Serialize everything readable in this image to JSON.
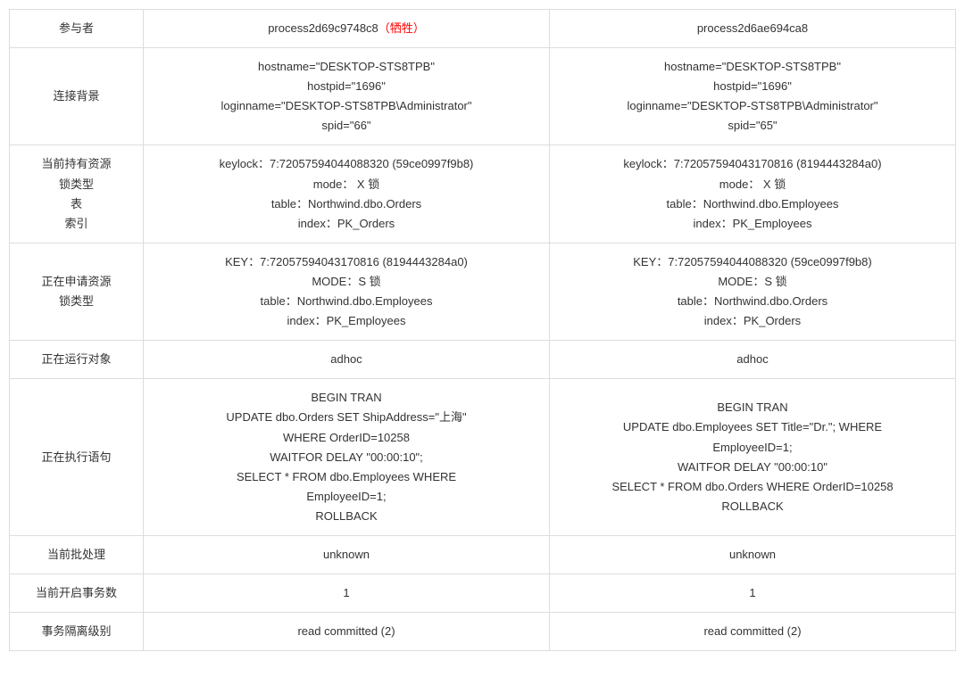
{
  "rows": {
    "participant": {
      "label": "参与者",
      "col1_main": "process2d69c9748c8",
      "col1_suffix": "（牺牲）",
      "col2": "process2d6ae694ca8"
    },
    "connection_bg": {
      "label": "连接背景",
      "col1": "hostname=\"DESKTOP-STS8TPB\"\nhostpid=\"1696\"\nloginname=\"DESKTOP-STS8TPB\\Administrator\"\nspid=\"66\"",
      "col2": "hostname=\"DESKTOP-STS8TPB\"\nhostpid=\"1696\"\nloginname=\"DESKTOP-STS8TPB\\Administrator\"\nspid=\"65\""
    },
    "current_resource": {
      "label": "当前持有资源\n锁类型\n表\n索引",
      "col1": "keylock：7:72057594044088320 (59ce0997f9b8)\nmode：   X 锁\ntable：Northwind.dbo.Orders\nindex：PK_Orders",
      "col2": "keylock：7:72057594043170816 (8194443284a0)\nmode：   X 锁\ntable：Northwind.dbo.Employees\nindex：PK_Employees"
    },
    "requesting_resource": {
      "label": "正在申请资源\n锁类型",
      "col1": "KEY：7:72057594043170816 (8194443284a0)\nMODE：S 锁\ntable：Northwind.dbo.Employees\nindex：PK_Employees",
      "col2": "KEY：7:72057594044088320 (59ce0997f9b8)\nMODE：S 锁\ntable：Northwind.dbo.Orders\nindex：PK_Orders"
    },
    "running_object": {
      "label": "正在运行对象",
      "col1": "adhoc",
      "col2": "adhoc"
    },
    "executing_stmt": {
      "label": "正在执行语句",
      "col1": "BEGIN TRAN\nUPDATE  dbo.Orders SET  ShipAddress=\"上海\"\nWHERE OrderID=10258\nWAITFOR DELAY \"00:00:10\";\nSELECT * FROM dbo.Employees WHERE\nEmployeeID=1;\nROLLBACK",
      "col2": "BEGIN TRAN\nUPDATE dbo.Employees SET Title=\"Dr.\"; WHERE\nEmployeeID=1;\nWAITFOR DELAY \"00:00:10\"\nSELECT * FROM dbo.Orders WHERE OrderID=10258\nROLLBACK"
    },
    "current_batch": {
      "label": "当前批处理",
      "col1": "unknown",
      "col2": "unknown"
    },
    "open_tran_count": {
      "label": "当前开启事务数",
      "col1": "1",
      "col2": "1"
    },
    "isolation_level": {
      "label": "事务隔离级别",
      "col1": "read committed (2)",
      "col2": "read committed (2)"
    }
  }
}
